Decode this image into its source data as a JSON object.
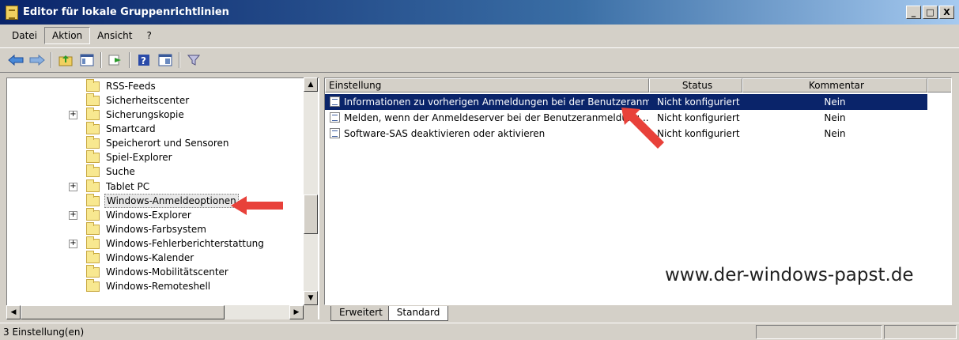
{
  "window": {
    "title": "Editor für lokale Gruppenrichtlinien",
    "buttons": [
      "_",
      "□",
      "X"
    ]
  },
  "menu": [
    "Datei",
    "Aktion",
    "Ansicht",
    "?"
  ],
  "toolbar": {
    "icons": [
      "back-icon",
      "forward-icon",
      "up-folder-icon",
      "show-hide-tree-icon",
      "export-list-icon",
      "help-icon",
      "properties-icon",
      "filter-icon"
    ]
  },
  "tree": {
    "items": [
      {
        "label": "RSS-Feeds",
        "expandable": false
      },
      {
        "label": "Sicherheitscenter",
        "expandable": false
      },
      {
        "label": "Sicherungskopie",
        "expandable": true
      },
      {
        "label": "Smartcard",
        "expandable": false
      },
      {
        "label": "Speicherort und Sensoren",
        "expandable": false
      },
      {
        "label": "Spiel-Explorer",
        "expandable": false
      },
      {
        "label": "Suche",
        "expandable": false
      },
      {
        "label": "Tablet PC",
        "expandable": true
      },
      {
        "label": "Windows-Anmeldeoptionen",
        "expandable": false,
        "selected": true
      },
      {
        "label": "Windows-Explorer",
        "expandable": true
      },
      {
        "label": "Windows-Farbsystem",
        "expandable": false
      },
      {
        "label": "Windows-Fehlerberichterstattung",
        "expandable": true
      },
      {
        "label": "Windows-Kalender",
        "expandable": false
      },
      {
        "label": "Windows-Mobilitätscenter",
        "expandable": false
      },
      {
        "label": "Windows-Remoteshell",
        "expandable": false
      }
    ]
  },
  "list": {
    "columns": [
      "Einstellung",
      "Status",
      "Kommentar"
    ],
    "rows": [
      {
        "setting": "Informationen zu vorherigen Anmeldungen bei der Benutzeranme...",
        "status": "Nicht konfiguriert",
        "comment": "Nein",
        "selected": true
      },
      {
        "setting": "Melden, wenn der Anmeldeserver bei der Benutzeranmeldung ...",
        "status": "Nicht konfiguriert",
        "comment": "Nein"
      },
      {
        "setting": "Software-SAS deaktivieren oder aktivieren",
        "status": "Nicht konfiguriert",
        "comment": "Nein"
      }
    ]
  },
  "watermark": "www.der-windows-papst.de",
  "tabs": [
    "Erweitert",
    "Standard"
  ],
  "active_tab": "Standard",
  "status": {
    "text": "3 Einstellung(en)"
  },
  "colors": {
    "selection": "#0a246a",
    "arrow": "#e8413a",
    "chrome": "#d4d0c8"
  }
}
